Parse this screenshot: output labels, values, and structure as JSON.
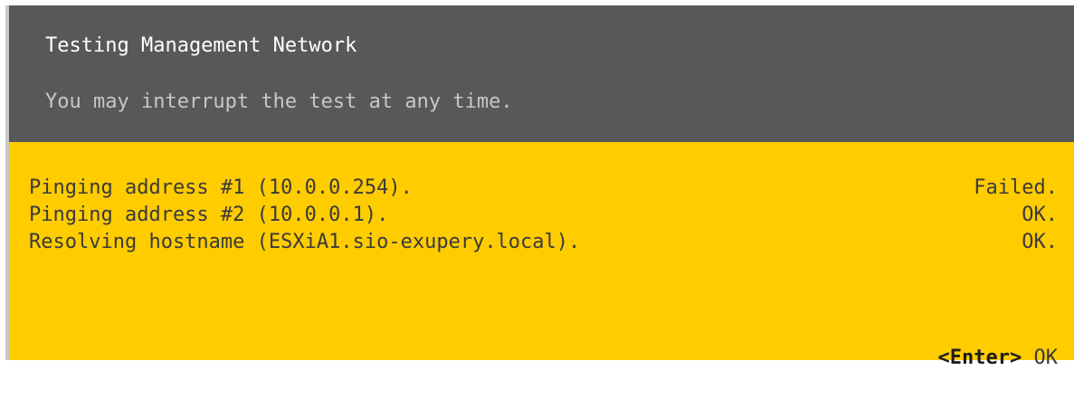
{
  "dialog": {
    "title": "Testing Management Network",
    "subtitle": "You may interrupt the test at any time."
  },
  "results": [
    {
      "label": "Pinging address #1 (10.0.0.254).",
      "status": "Failed."
    },
    {
      "label": "Pinging address #2 (10.0.0.1).",
      "status": "OK."
    },
    {
      "label": "Resolving hostname (ESXiA1.sio-exupery.local).",
      "status": "OK."
    }
  ],
  "footer": {
    "key": "<Enter>",
    "action": "OK"
  },
  "colors": {
    "header_bg": "#585858",
    "body_bg": "#ffcc00",
    "title_text": "#ffffff",
    "subtitle_text": "#c7c7c7",
    "body_text": "#3a3a3a"
  }
}
